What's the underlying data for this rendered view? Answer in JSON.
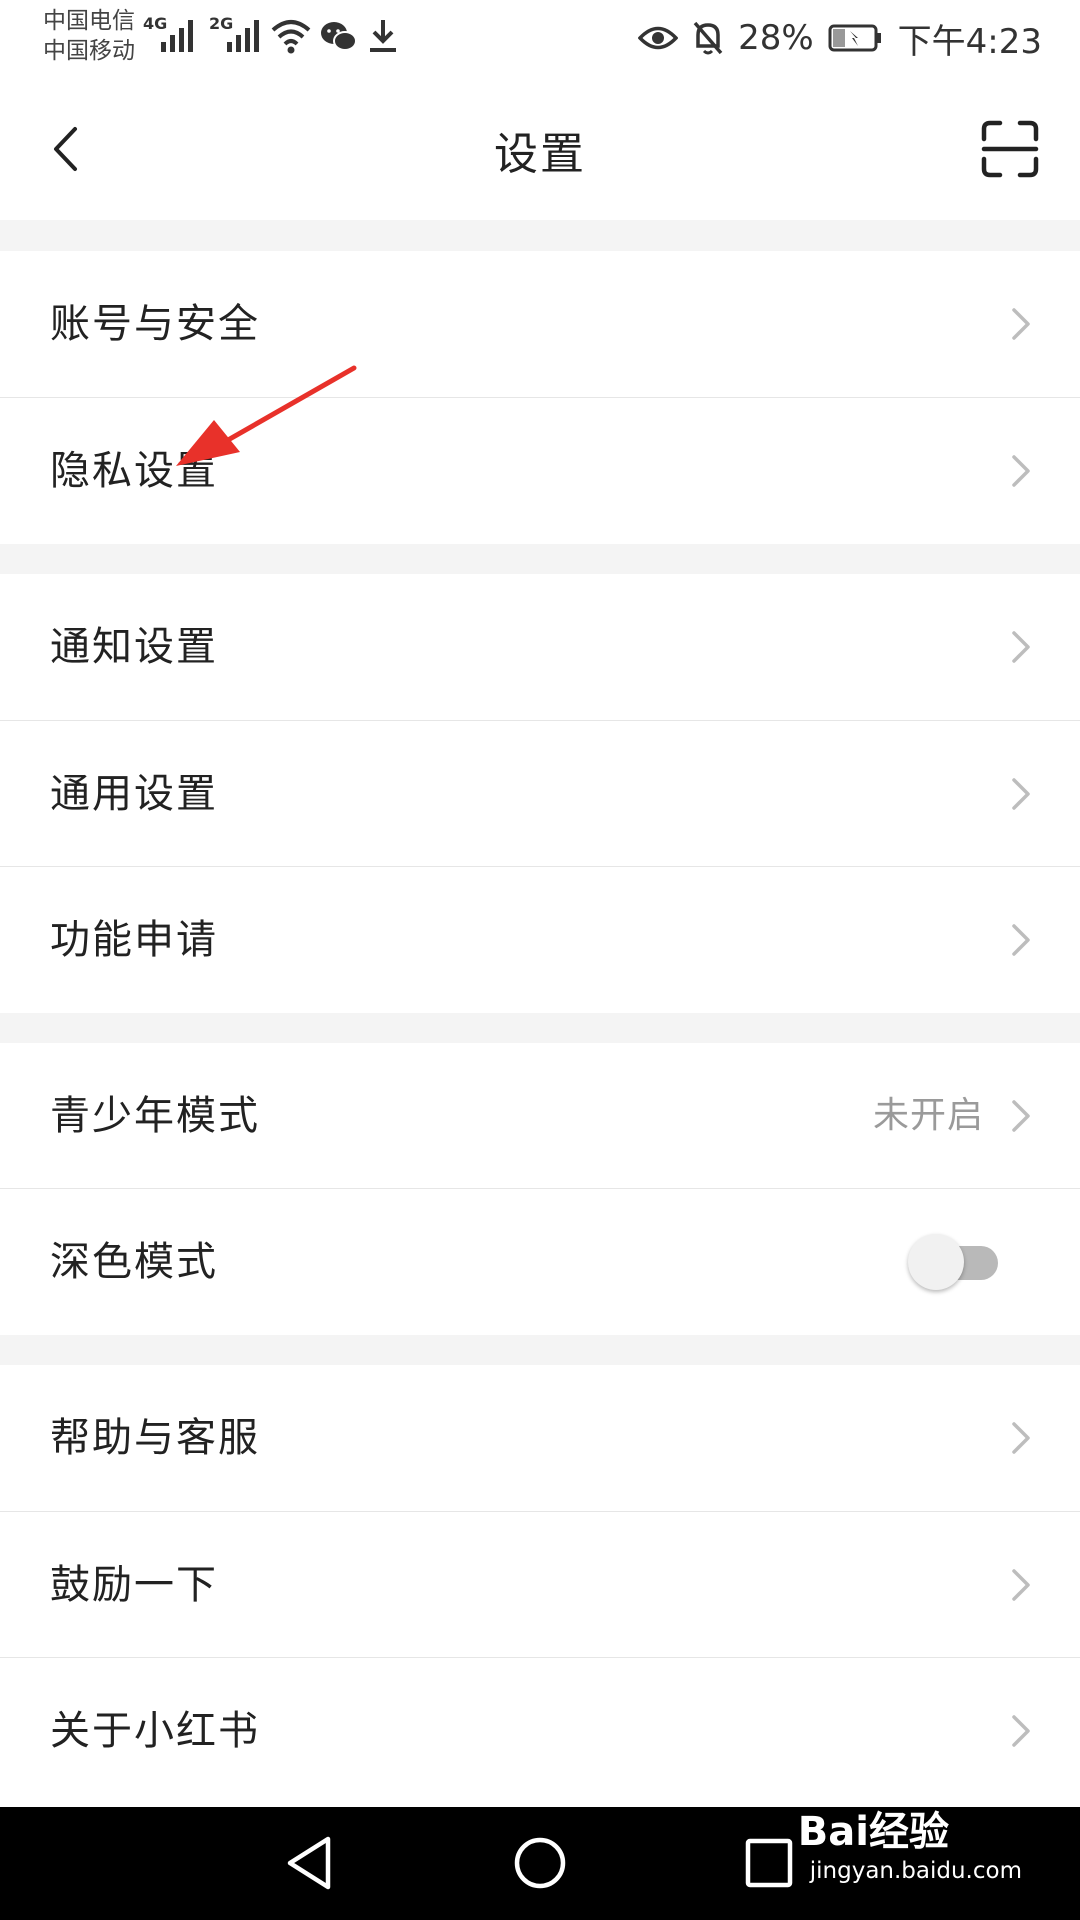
{
  "status_bar": {
    "carrier_1": "中国电信",
    "carrier_2": "中国移动",
    "network_1": "4G",
    "network_2": "2G",
    "battery": "28%",
    "time": "下午4:23",
    "icons": [
      "signal-icon",
      "wifi-icon",
      "wechat-icon",
      "download-icon",
      "eye-icon",
      "bell-off-icon",
      "battery-charging-icon"
    ]
  },
  "title_bar": {
    "title": "设置",
    "back_icon": "chevron-left-icon",
    "scan_icon": "scan-icon"
  },
  "groups": [
    {
      "items": [
        {
          "label": "账号与安全",
          "value": "",
          "control": "chevron"
        },
        {
          "label": "隐私设置",
          "value": "",
          "control": "chevron"
        }
      ]
    },
    {
      "items": [
        {
          "label": "通知设置",
          "value": "",
          "control": "chevron"
        },
        {
          "label": "通用设置",
          "value": "",
          "control": "chevron"
        },
        {
          "label": "功能申请",
          "value": "",
          "control": "chevron"
        }
      ]
    },
    {
      "items": [
        {
          "label": "青少年模式",
          "value": "未开启",
          "control": "chevron"
        },
        {
          "label": "深色模式",
          "value": "",
          "control": "toggle",
          "toggle_on": false
        }
      ]
    },
    {
      "items": [
        {
          "label": "帮助与客服",
          "value": "",
          "control": "chevron"
        },
        {
          "label": "鼓励一下",
          "value": "",
          "control": "chevron"
        },
        {
          "label": "关于小红书",
          "value": "",
          "control": "chevron"
        }
      ]
    }
  ],
  "annotation": {
    "type": "arrow",
    "color": "#e8312a",
    "points_to": "隐私设置"
  },
  "nav_bar": {
    "buttons": [
      "back-triangle-icon",
      "home-circle-icon",
      "recents-square-icon"
    ]
  },
  "watermark": {
    "logo": "Bai经验",
    "url": "jingyan.baidu.com"
  },
  "colors": {
    "background": "#ffffff",
    "section_gap": "#f4f4f4",
    "divider": "#e6e6e6",
    "text_primary": "#222222",
    "text_secondary": "#9a9a9a",
    "chevron": "#bdbdbd",
    "nav_bar": "#000000"
  }
}
